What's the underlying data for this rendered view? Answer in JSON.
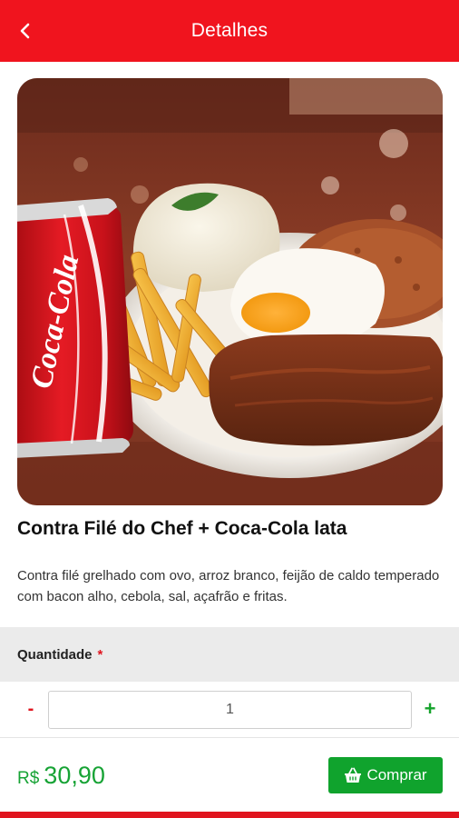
{
  "header": {
    "title": "Detalhes",
    "back_icon": "chevron-left-icon"
  },
  "product": {
    "image_alt": "Prato com arroz, ovo frito, batata frita, feijão e carne com lata de Coca-Cola",
    "can_logo": "Coca-Cola",
    "title": "Contra Filé do Chef + Coca-Cola lata",
    "description": "Contra filé grelhado com ovo, arroz branco, feijão de caldo temperado com bacon alho, cebola, sal, açafrão e fritas."
  },
  "quantity": {
    "label": "Quantidade",
    "required_mark": "*",
    "minus_label": "-",
    "plus_label": "+",
    "value": "1"
  },
  "footer": {
    "currency": "R$",
    "price": "30,90",
    "buy_label": "Comprar",
    "buy_icon": "basket-icon"
  },
  "colors": {
    "brand_red": "#f0141e",
    "buy_green": "#10a32d",
    "price_green": "#17a335"
  }
}
